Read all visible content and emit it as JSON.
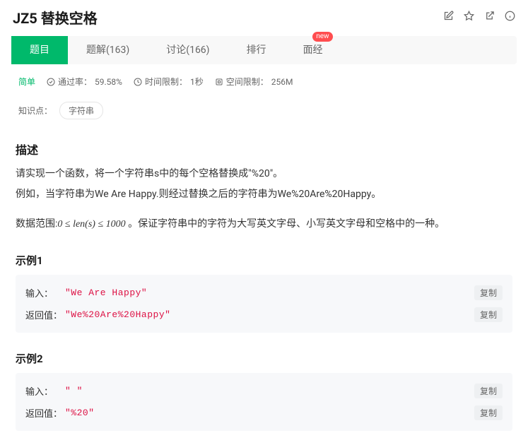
{
  "title": "JZ5 替换空格",
  "tabs": [
    {
      "label": "题目"
    },
    {
      "label": "题解(163)"
    },
    {
      "label": "讨论(166)"
    },
    {
      "label": "排行"
    },
    {
      "label": "面经"
    }
  ],
  "new_badge": "new",
  "meta": {
    "difficulty": "简单",
    "pass_label": "通过率：",
    "pass_value": "59.58%",
    "time_label": "时间限制：",
    "time_value": "1秒",
    "space_label": "空间限制：",
    "space_value": "256M"
  },
  "tags": {
    "label": "知识点：",
    "items": [
      "字符串"
    ]
  },
  "desc": {
    "heading": "描述",
    "p1": "请实现一个函数，将一个字符串s中的每个空格替换成\"%20\"。",
    "p2": "例如，当字符串为We Are Happy.则经过替换之后的字符串为We%20Are%20Happy。",
    "p3_prefix": "数据范围:",
    "p3_math": "0 ≤ len(s) ≤ 1000",
    "p3_suffix": " 。保证字符串中的字符为大写英文字母、小写英文字母和空格中的一种。"
  },
  "examples": [
    {
      "title": "示例1",
      "rows": [
        {
          "label": "输入：",
          "value": "\"We Are Happy\""
        },
        {
          "label": "返回值：",
          "value": "\"We%20Are%20Happy\""
        }
      ]
    },
    {
      "title": "示例2",
      "rows": [
        {
          "label": "输入：",
          "value": "\" \""
        },
        {
          "label": "返回值：",
          "value": "\"%20\""
        }
      ]
    }
  ],
  "copy_label": "复制"
}
